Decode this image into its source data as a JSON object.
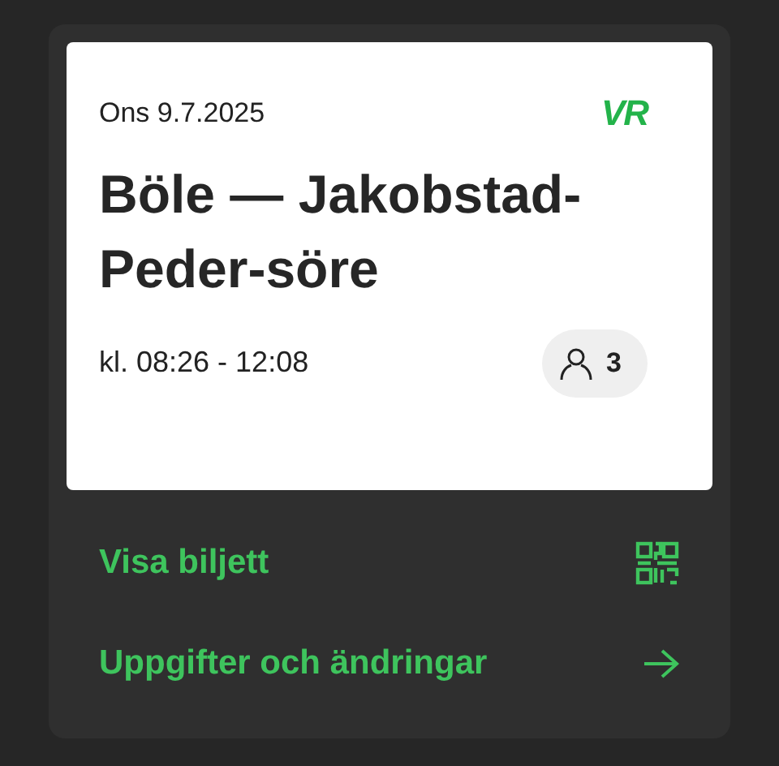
{
  "ticket": {
    "date": "Ons 9.7.2025",
    "logo": "VR",
    "route": "Böle — Jakobstad-Peder-söre",
    "time": "kl. 08:26 - 12:08",
    "passengers": "3"
  },
  "actions": [
    {
      "label": "Visa biljett",
      "kind": "qr"
    },
    {
      "label": "Uppgifter och ändringar",
      "kind": "arrow"
    }
  ]
}
